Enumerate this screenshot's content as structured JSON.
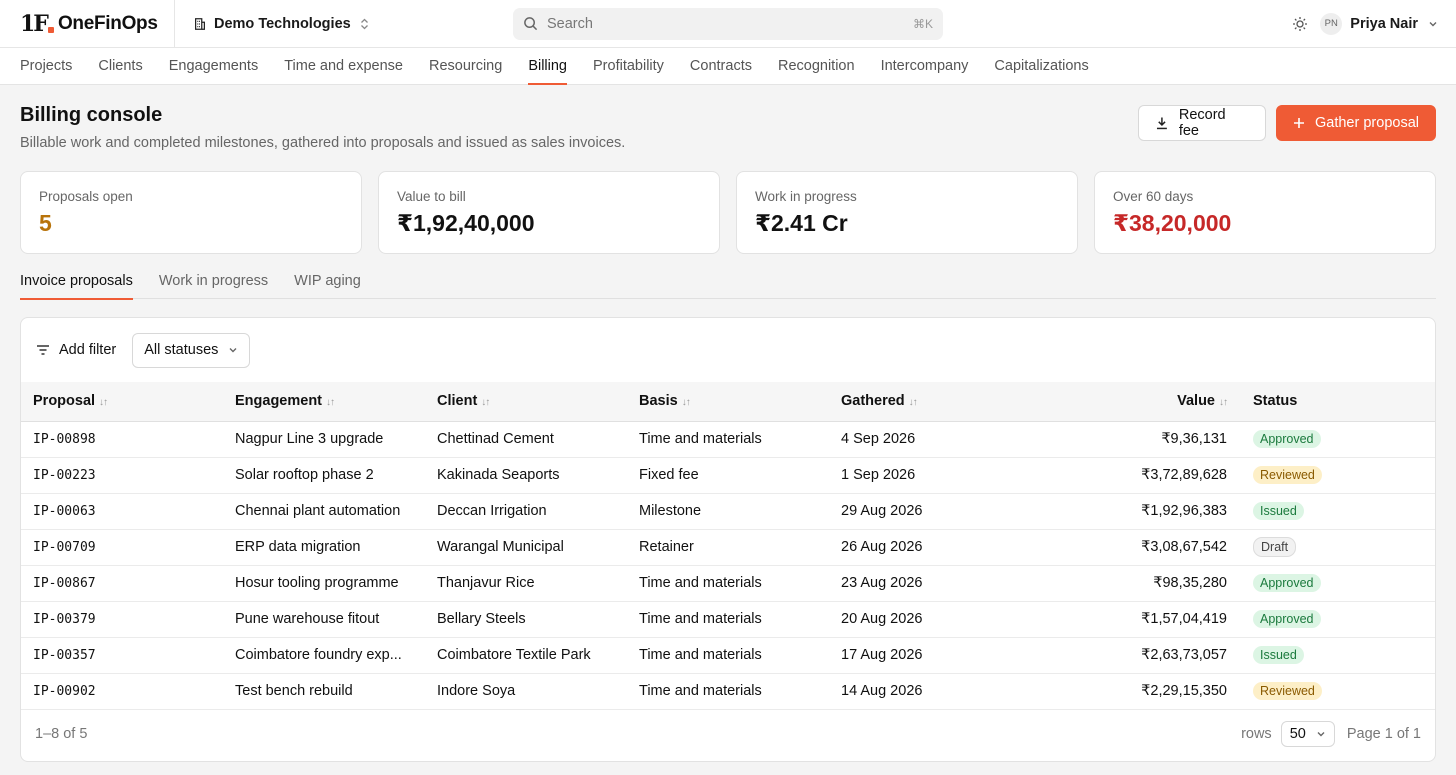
{
  "brand": {
    "mark": "1F",
    "name": "OneFinOps"
  },
  "workspace": {
    "name": "Demo Technologies"
  },
  "search": {
    "placeholder": "Search",
    "shortcut": "⌘K"
  },
  "user": {
    "initials": "PN",
    "name": "Priya Nair"
  },
  "nav": [
    "Projects",
    "Clients",
    "Engagements",
    "Time and expense",
    "Resourcing",
    "Billing",
    "Profitability",
    "Contracts",
    "Recognition",
    "Intercompany",
    "Capitalizations"
  ],
  "nav_active": "Billing",
  "page": {
    "title": "Billing console",
    "subtitle": "Billable work and completed milestones, gathered into proposals and issued as sales invoices.",
    "record_label": "Record fee",
    "gather_label": "Gather proposal"
  },
  "kpis": [
    {
      "label": "Proposals open",
      "value": "5",
      "color": "#b8730a"
    },
    {
      "label": "Value to bill",
      "value": "₹1,92,40,000",
      "color": "#111111"
    },
    {
      "label": "Work in progress",
      "value": "₹2.41 Cr",
      "color": "#111111"
    },
    {
      "label": "Over 60 days",
      "value": "₹38,20,000",
      "color": "#c62828"
    }
  ],
  "tabs": [
    "Invoice proposals",
    "Work in progress",
    "WIP aging"
  ],
  "tab_active": "Invoice proposals",
  "filters": {
    "add_filter_label": "Add filter",
    "status_value": "All statuses"
  },
  "table": {
    "columns": [
      "Proposal",
      "Engagement",
      "Client",
      "Basis",
      "Gathered",
      "Value",
      "Status"
    ],
    "rows": [
      {
        "proposal": "IP-00898",
        "engagement": "Nagpur Line 3 upgrade",
        "client": "Chettinad Cement",
        "basis": "Time and materials",
        "gathered": "4 Sep 2026",
        "value": "₹9,36,131",
        "status": "Approved"
      },
      {
        "proposal": "IP-00223",
        "engagement": "Solar rooftop phase 2",
        "client": "Kakinada Seaports",
        "basis": "Fixed fee",
        "gathered": "1 Sep 2026",
        "value": "₹3,72,89,628",
        "status": "Reviewed"
      },
      {
        "proposal": "IP-00063",
        "engagement": "Chennai plant automation",
        "client": "Deccan Irrigation",
        "basis": "Milestone",
        "gathered": "29 Aug 2026",
        "value": "₹1,92,96,383",
        "status": "Issued"
      },
      {
        "proposal": "IP-00709",
        "engagement": "ERP data migration",
        "client": "Warangal Municipal",
        "basis": "Retainer",
        "gathered": "26 Aug 2026",
        "value": "₹3,08,67,542",
        "status": "Draft"
      },
      {
        "proposal": "IP-00867",
        "engagement": "Hosur tooling programme",
        "client": "Thanjavur Rice",
        "basis": "Time and materials",
        "gathered": "23 Aug 2026",
        "value": "₹98,35,280",
        "status": "Approved"
      },
      {
        "proposal": "IP-00379",
        "engagement": "Pune warehouse fitout",
        "client": "Bellary Steels",
        "basis": "Time and materials",
        "gathered": "20 Aug 2026",
        "value": "₹1,57,04,419",
        "status": "Approved"
      },
      {
        "proposal": "IP-00357",
        "engagement": "Coimbatore foundry exp...",
        "client": "Coimbatore Textile Park",
        "basis": "Time and materials",
        "gathered": "17 Aug 2026",
        "value": "₹2,63,73,057",
        "status": "Issued"
      },
      {
        "proposal": "IP-00902",
        "engagement": "Test bench rebuild",
        "client": "Indore Soya",
        "basis": "Time and materials",
        "gathered": "14 Aug 2026",
        "value": "₹2,29,15,350",
        "status": "Reviewed"
      }
    ]
  },
  "footer": {
    "range": "1–8 of 5",
    "rows_label": "rows",
    "rows_value": "50",
    "page_label": "Page 1 of 1"
  },
  "colors": {
    "accent": "#ef5b35",
    "kpi_open": "#b8730a",
    "kpi_over60": "#c62828"
  }
}
